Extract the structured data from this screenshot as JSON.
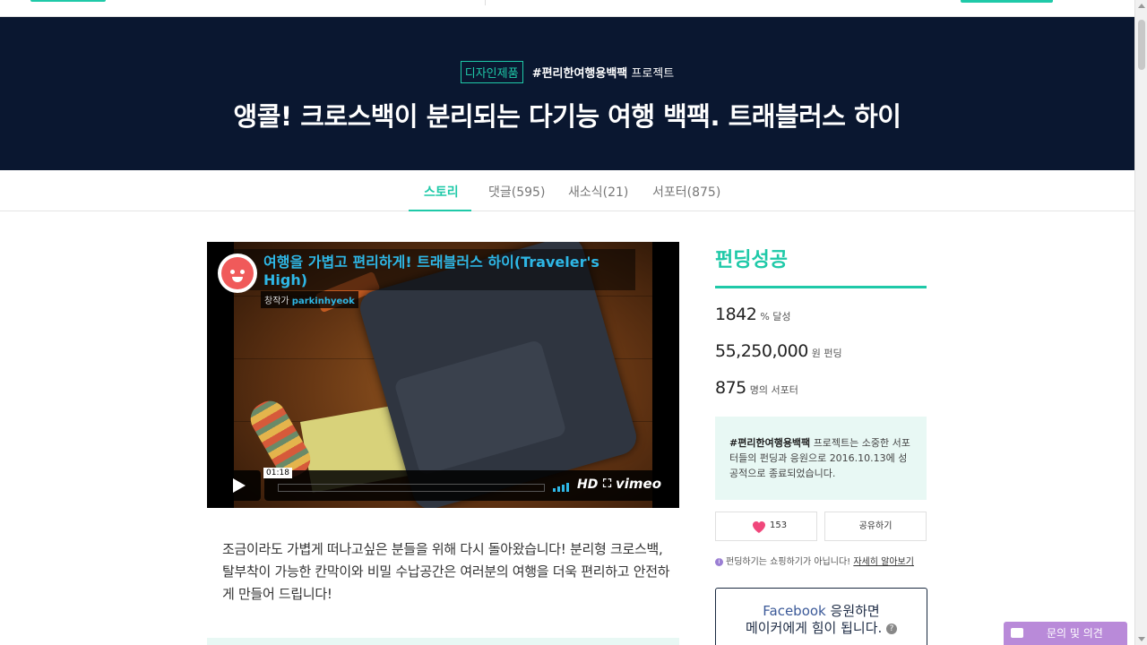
{
  "project": {
    "category": "디자인제품",
    "hashtag": "#편리한여행용백팩",
    "hashtag_suffix": "프로젝트",
    "title": "앵콜! 크로스백이 분리되는 다기능 여행 백팩. 트래블러스 하이"
  },
  "tabs": [
    {
      "label": "스토리"
    },
    {
      "label": "댓글(595)"
    },
    {
      "label": "새소식(21)"
    },
    {
      "label": "서포터(875)"
    }
  ],
  "video": {
    "title": "여행을 가볍고 편리하게! 트래블러스 하이(Traveler's High)",
    "by_prefix": "창작가",
    "author": "parkinhyeok",
    "time": "01:18",
    "hd_label": "HD",
    "brand": "vimeo"
  },
  "intro_text": "조금이라도 가볍게 떠나고싶은 분들을 위해 다시 돌아왔습니다! 분리형 크로스백, 탈부착이 가능한 칸막이와 비밀 수납공간은 여러분의 여행을 더욱 편리하고 안전하게 만들어 드립니다!",
  "sidebar": {
    "status": "펀딩성공",
    "percent": "1842",
    "percent_unit": "% 달성",
    "amount": "55,250,000",
    "amount_unit": "원 펀딩",
    "supporters": "875",
    "supporters_unit": "명의 서포터",
    "notice_bold": "#편리한여행용백팩",
    "notice_text": "프로젝트는 소중한 서포터들의 펀딩과 응원으로 2016.10.13에 성공적으로 종료되었습니다.",
    "like_count": "153",
    "share_label": "공유하기",
    "info_text": "펀딩하기는 쇼핑하기가 아닙니다!",
    "info_link": "자세히 알아보기",
    "fb_brand": "Facebook",
    "fb_line1_suffix": "응원하면",
    "fb_line2": "메이커에게 힘이 됩니다.",
    "fb_help": "?"
  },
  "feedback": {
    "label": "문의 및 의견"
  },
  "colors": {
    "accent": "#1fc9a8",
    "hero_bg": "#0a1730",
    "video_title": "#2eb7e6",
    "heart": "#f0477b",
    "feedback": "#b98ad9"
  }
}
